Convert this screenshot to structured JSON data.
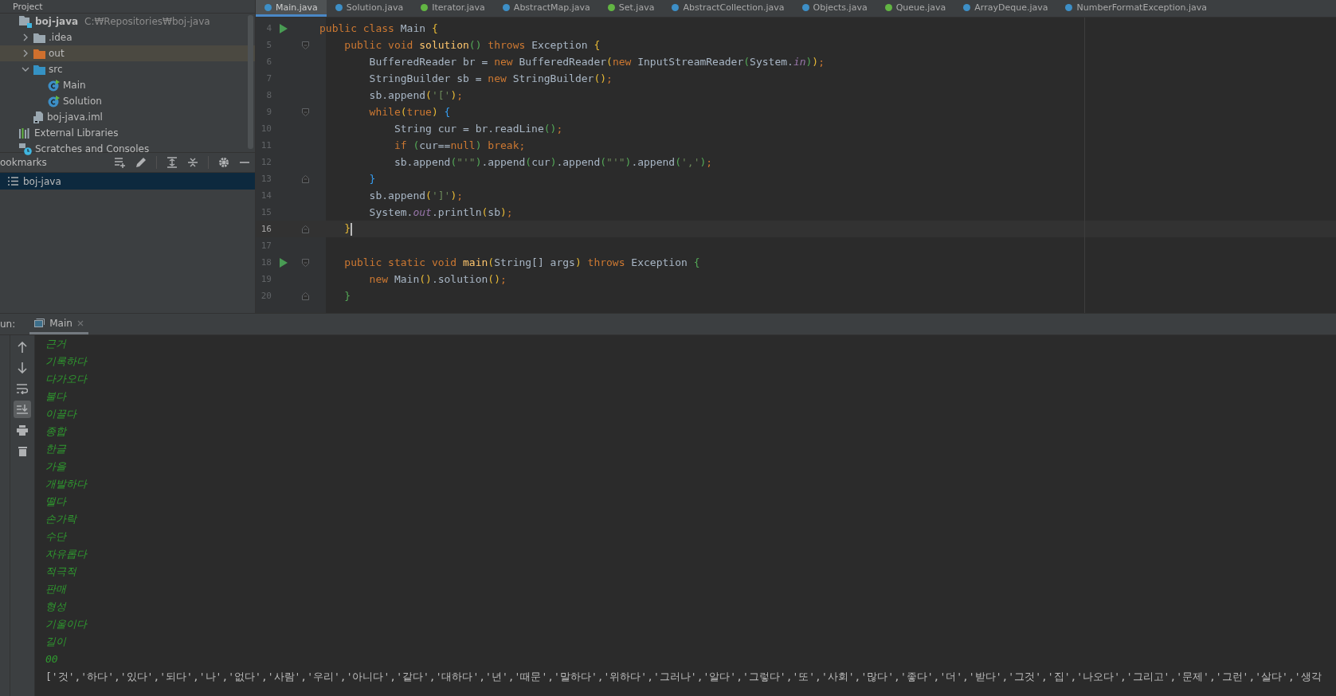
{
  "project": {
    "title": "Project",
    "tree": [
      {
        "label": "boj-java",
        "kind": "module",
        "hint": "C:₩Repositories₩boj-java",
        "selected": false,
        "children": [
          {
            "label": ".idea",
            "kind": "folder",
            "expanded": false,
            "selected": false
          },
          {
            "label": "out",
            "kind": "excluded-folder",
            "expanded": false,
            "selected": true
          },
          {
            "label": "src",
            "kind": "source-folder",
            "expanded": true,
            "selected": false,
            "children": [
              {
                "label": "Main",
                "kind": "class",
                "selected": false
              },
              {
                "label": "Solution",
                "kind": "class",
                "selected": false
              }
            ]
          },
          {
            "label": "boj-java.iml",
            "kind": "file",
            "selected": false
          }
        ]
      },
      {
        "label": "External Libraries",
        "kind": "libraries",
        "selected": false
      },
      {
        "label": "Scratches and Consoles",
        "kind": "scratches",
        "selected": false
      }
    ]
  },
  "bookmarks": {
    "title": "ookmarks",
    "items": [
      {
        "label": "boj-java",
        "selected": true
      }
    ]
  },
  "editor_tabs": [
    {
      "label": "Main.java",
      "selected": true,
      "color": "#3d8fc7"
    },
    {
      "label": "Solution.java",
      "selected": false,
      "color": "#3d8fc7"
    },
    {
      "label": "Iterator.java",
      "selected": false,
      "color": "#62b543"
    },
    {
      "label": "AbstractMap.java",
      "selected": false,
      "color": "#3d8fc7"
    },
    {
      "label": "Set.java",
      "selected": false,
      "color": "#62b543"
    },
    {
      "label": "AbstractCollection.java",
      "selected": false,
      "color": "#3d8fc7"
    },
    {
      "label": "Objects.java",
      "selected": false,
      "color": "#3d8fc7"
    },
    {
      "label": "Queue.java",
      "selected": false,
      "color": "#62b543"
    },
    {
      "label": "ArrayDeque.java",
      "selected": false,
      "color": "#3d8fc7"
    },
    {
      "label": "NumberFormatException.java",
      "selected": false,
      "color": "#3d8fc7"
    }
  ],
  "code": [
    {
      "number": "4",
      "run": true,
      "fold_start": false,
      "fold_end": false,
      "current": false,
      "tokens": [
        {
          "t": "public class ",
          "kind": "kw"
        },
        {
          "t": "Main ",
          "kind": "plain"
        },
        {
          "t": "{",
          "kind": "p1"
        }
      ]
    },
    {
      "number": "5",
      "run": false,
      "fold_start": true,
      "fold_end": false,
      "current": false,
      "tokens": [
        {
          "t": "    public void ",
          "kind": "kw"
        },
        {
          "t": "solution",
          "kind": "fn"
        },
        {
          "t": "() ",
          "kind": "p2"
        },
        {
          "t": "throws ",
          "kind": "kw"
        },
        {
          "t": "Exception ",
          "kind": "plain"
        },
        {
          "t": "{",
          "kind": "p1"
        }
      ]
    },
    {
      "number": "6",
      "run": false,
      "fold_start": false,
      "fold_end": false,
      "current": false,
      "tokens": [
        {
          "t": "        BufferedReader br = ",
          "kind": "plain"
        },
        {
          "t": "new ",
          "kind": "kw"
        },
        {
          "t": "BufferedReader",
          "kind": "plain"
        },
        {
          "t": "(",
          "kind": "p1"
        },
        {
          "t": "new ",
          "kind": "kw"
        },
        {
          "t": "InputStreamReader",
          "kind": "plain"
        },
        {
          "t": "(",
          "kind": "p2"
        },
        {
          "t": "System.",
          "kind": "plain"
        },
        {
          "t": "in",
          "kind": "fld"
        },
        {
          "t": ")",
          "kind": "p2"
        },
        {
          "t": ")",
          "kind": "p1"
        },
        {
          "t": ";",
          "kind": "kw"
        }
      ]
    },
    {
      "number": "7",
      "run": false,
      "fold_start": false,
      "fold_end": false,
      "current": false,
      "tokens": [
        {
          "t": "        StringBuilder sb = ",
          "kind": "plain"
        },
        {
          "t": "new ",
          "kind": "kw"
        },
        {
          "t": "StringBuilder",
          "kind": "plain"
        },
        {
          "t": "()",
          "kind": "p1"
        },
        {
          "t": ";",
          "kind": "kw"
        }
      ]
    },
    {
      "number": "8",
      "run": false,
      "fold_start": false,
      "fold_end": false,
      "current": false,
      "tokens": [
        {
          "t": "        sb.append",
          "kind": "plain"
        },
        {
          "t": "(",
          "kind": "p1"
        },
        {
          "t": "'['",
          "kind": "str"
        },
        {
          "t": ")",
          "kind": "p1"
        },
        {
          "t": ";",
          "kind": "kw"
        }
      ]
    },
    {
      "number": "9",
      "run": false,
      "fold_start": true,
      "fold_end": false,
      "current": false,
      "tokens": [
        {
          "t": "        while",
          "kind": "kw"
        },
        {
          "t": "(",
          "kind": "p1"
        },
        {
          "t": "true",
          "kind": "kw"
        },
        {
          "t": ") ",
          "kind": "p1"
        },
        {
          "t": "{",
          "kind": "p3"
        }
      ]
    },
    {
      "number": "10",
      "run": false,
      "fold_start": false,
      "fold_end": false,
      "current": false,
      "tokens": [
        {
          "t": "            String cur = br.readLine",
          "kind": "plain"
        },
        {
          "t": "()",
          "kind": "p2"
        },
        {
          "t": ";",
          "kind": "kw"
        }
      ]
    },
    {
      "number": "11",
      "run": false,
      "fold_start": false,
      "fold_end": false,
      "current": false,
      "tokens": [
        {
          "t": "            if ",
          "kind": "kw"
        },
        {
          "t": "(",
          "kind": "p2"
        },
        {
          "t": "cur==",
          "kind": "plain"
        },
        {
          "t": "null",
          "kind": "kw"
        },
        {
          "t": ") ",
          "kind": "p2"
        },
        {
          "t": "break;",
          "kind": "kw"
        }
      ]
    },
    {
      "number": "12",
      "run": false,
      "fold_start": false,
      "fold_end": false,
      "current": false,
      "tokens": [
        {
          "t": "            sb.append",
          "kind": "plain"
        },
        {
          "t": "(",
          "kind": "p2"
        },
        {
          "t": "\"'\"",
          "kind": "str"
        },
        {
          "t": ")",
          "kind": "p2"
        },
        {
          "t": ".append",
          "kind": "plain"
        },
        {
          "t": "(",
          "kind": "p2"
        },
        {
          "t": "cur",
          "kind": "plain"
        },
        {
          "t": ")",
          "kind": "p2"
        },
        {
          "t": ".append",
          "kind": "plain"
        },
        {
          "t": "(",
          "kind": "p2"
        },
        {
          "t": "\"'\"",
          "kind": "str"
        },
        {
          "t": ")",
          "kind": "p2"
        },
        {
          "t": ".append",
          "kind": "plain"
        },
        {
          "t": "(",
          "kind": "p2"
        },
        {
          "t": "','",
          "kind": "str"
        },
        {
          "t": ")",
          "kind": "p2"
        },
        {
          "t": ";",
          "kind": "kw"
        }
      ]
    },
    {
      "number": "13",
      "run": false,
      "fold_start": false,
      "fold_end": true,
      "current": false,
      "tokens": [
        {
          "t": "        }",
          "kind": "p3"
        }
      ]
    },
    {
      "number": "14",
      "run": false,
      "fold_start": false,
      "fold_end": false,
      "current": false,
      "tokens": [
        {
          "t": "        sb.append",
          "kind": "plain"
        },
        {
          "t": "(",
          "kind": "p1"
        },
        {
          "t": "']'",
          "kind": "str"
        },
        {
          "t": ")",
          "kind": "p1"
        },
        {
          "t": ";",
          "kind": "kw"
        }
      ]
    },
    {
      "number": "15",
      "run": false,
      "fold_start": false,
      "fold_end": false,
      "current": false,
      "tokens": [
        {
          "t": "        System.",
          "kind": "plain"
        },
        {
          "t": "out",
          "kind": "fld"
        },
        {
          "t": ".println",
          "kind": "plain"
        },
        {
          "t": "(",
          "kind": "p1"
        },
        {
          "t": "sb",
          "kind": "plain"
        },
        {
          "t": ")",
          "kind": "p1"
        },
        {
          "t": ";",
          "kind": "kw"
        }
      ]
    },
    {
      "number": "16",
      "run": false,
      "fold_start": false,
      "fold_end": true,
      "current": true,
      "tokens": [
        {
          "t": "    }",
          "kind": "p1"
        }
      ]
    },
    {
      "number": "17",
      "run": false,
      "fold_start": false,
      "fold_end": false,
      "current": false
    },
    {
      "number": "18",
      "run": true,
      "fold_start": true,
      "fold_end": false,
      "current": false,
      "tokens": [
        {
          "t": "    public static void ",
          "kind": "kw"
        },
        {
          "t": "main",
          "kind": "fn"
        },
        {
          "t": "(",
          "kind": "p1"
        },
        {
          "t": "String[] args",
          "kind": "plain"
        },
        {
          "t": ") ",
          "kind": "p1"
        },
        {
          "t": "throws ",
          "kind": "kw"
        },
        {
          "t": "Exception ",
          "kind": "plain"
        },
        {
          "t": "{",
          "kind": "p2"
        }
      ]
    },
    {
      "number": "19",
      "run": false,
      "fold_start": false,
      "fold_end": false,
      "current": false,
      "tokens": [
        {
          "t": "        new ",
          "kind": "kw"
        },
        {
          "t": "Main",
          "kind": "plain"
        },
        {
          "t": "()",
          "kind": "p1"
        },
        {
          "t": ".solution",
          "kind": "plain"
        },
        {
          "t": "()",
          "kind": "p1"
        },
        {
          "t": ";",
          "kind": "kw"
        }
      ]
    },
    {
      "number": "20",
      "run": false,
      "fold_start": false,
      "fold_end": true,
      "current": false,
      "tokens": [
        {
          "t": "    }",
          "kind": "p2"
        }
      ]
    }
  ],
  "run": {
    "label": "un:",
    "tabs": [
      {
        "label": "Main",
        "selected": true
      }
    ],
    "tools": [
      {
        "kind": "up",
        "selected": false
      },
      {
        "kind": "down",
        "selected": false
      },
      {
        "kind": "wrap",
        "selected": false
      },
      {
        "kind": "scroll-end",
        "selected": true
      },
      {
        "kind": "print",
        "selected": false
      },
      {
        "kind": "trash",
        "selected": false
      }
    ],
    "output": [
      {
        "text": "근거",
        "kind": "input"
      },
      {
        "text": "기록하다",
        "kind": "input"
      },
      {
        "text": "다가오다",
        "kind": "input"
      },
      {
        "text": "불다",
        "kind": "input"
      },
      {
        "text": "이끌다",
        "kind": "input"
      },
      {
        "text": "종합",
        "kind": "input"
      },
      {
        "text": "한글",
        "kind": "input"
      },
      {
        "text": "가을",
        "kind": "input"
      },
      {
        "text": "개발하다",
        "kind": "input"
      },
      {
        "text": "떨다",
        "kind": "input"
      },
      {
        "text": "손가락",
        "kind": "input"
      },
      {
        "text": "수단",
        "kind": "input"
      },
      {
        "text": "자유롭다",
        "kind": "input"
      },
      {
        "text": "적극적",
        "kind": "input"
      },
      {
        "text": "판매",
        "kind": "input"
      },
      {
        "text": "형성",
        "kind": "input"
      },
      {
        "text": "기울이다",
        "kind": "input"
      },
      {
        "text": "길이",
        "kind": "input"
      },
      {
        "text": "00",
        "kind": "input"
      },
      {
        "text": "['것','하다','있다','되다','나','없다','사람','우리','아니다','같다','대하다','년','때문','말하다','위하다','그러나','알다','그렇다','또','사회','많다','좋다','더','받다','그것','집','나오다','그리고','문제','그런','살다','생각",
        "kind": "output"
      }
    ]
  }
}
